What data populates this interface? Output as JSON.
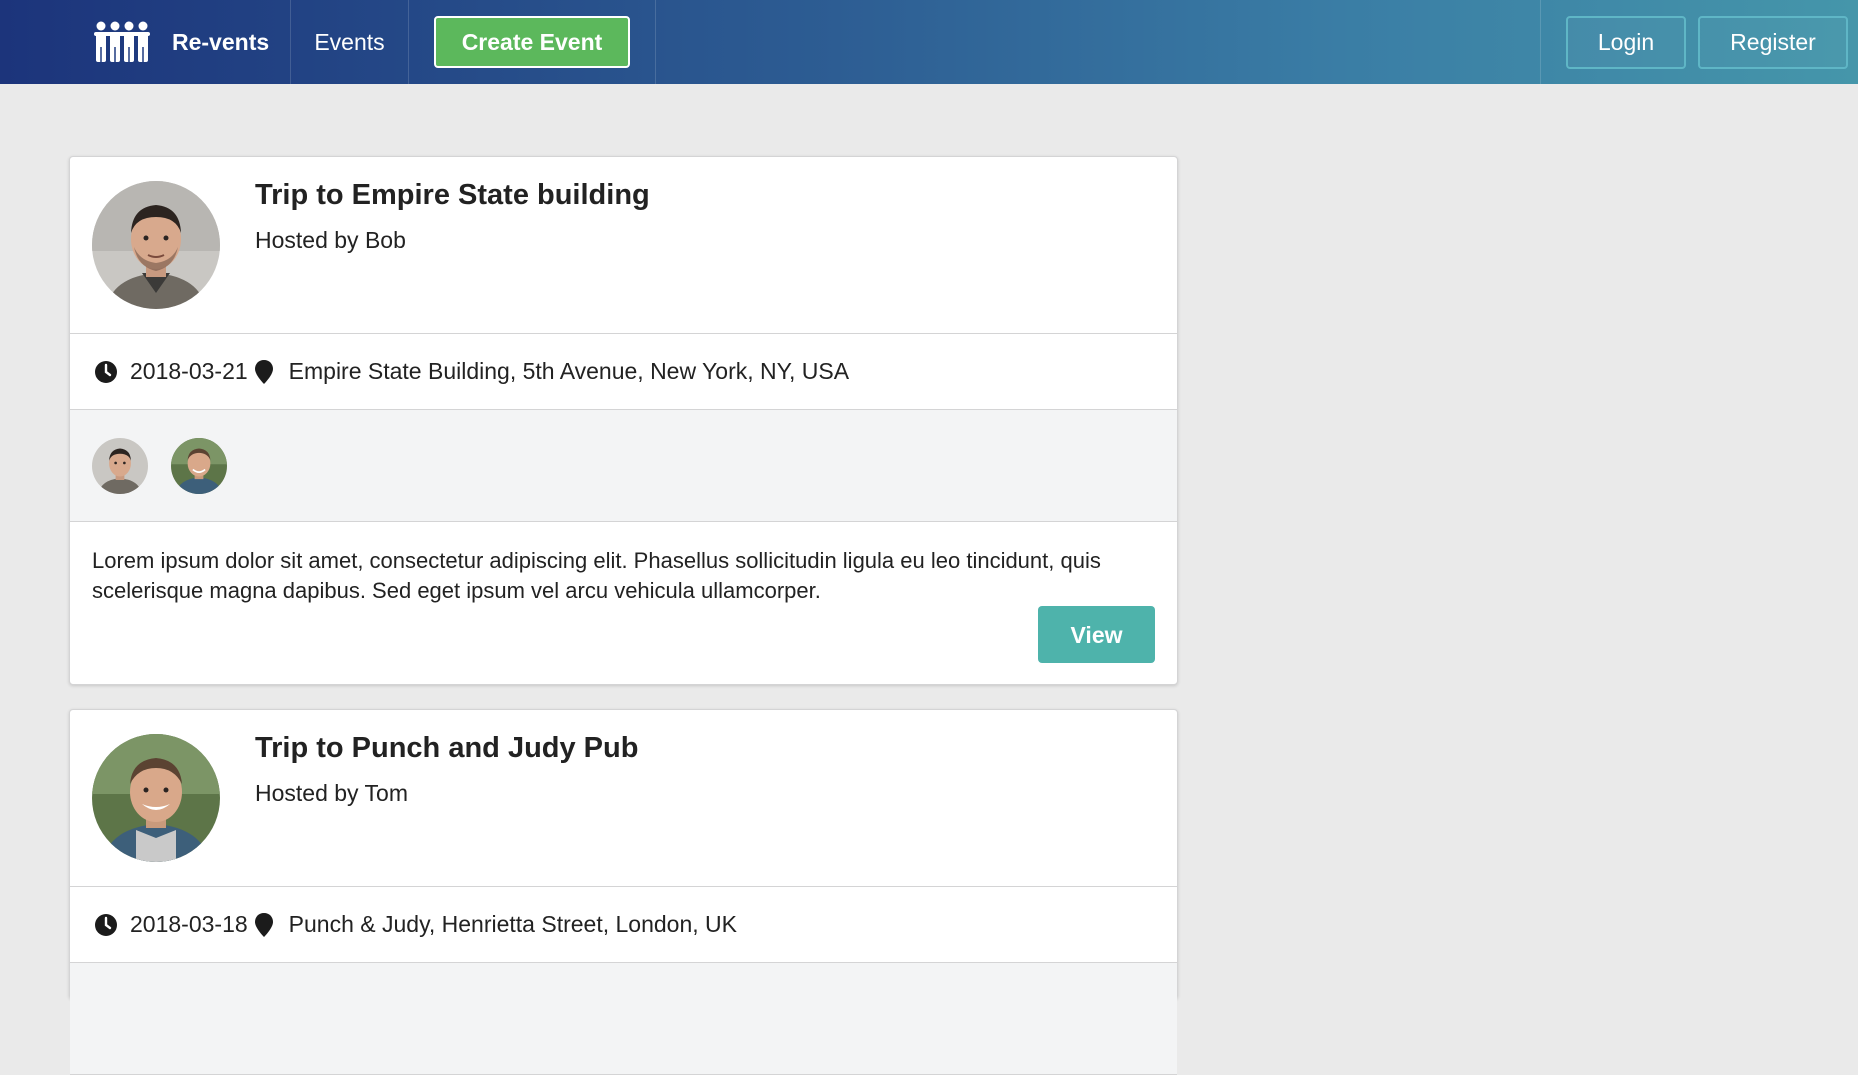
{
  "nav": {
    "brand": "Re-vents",
    "events": "Events",
    "create_event": "Create Event",
    "login": "Login",
    "register": "Register",
    "logo_icon": "people-group-icon"
  },
  "events": [
    {
      "title": "Trip to Empire State building",
      "hosted_by": "Hosted by Bob",
      "date": "2018-03-21",
      "venue": "Empire State Building, 5th Avenue, New York, NY, USA",
      "description": "Lorem ipsum dolor sit amet, consectetur adipiscing elit. Phasellus sollicitudin ligula eu leo tincidunt, quis scelerisque magna dapibus. Sed eget ipsum vel arcu vehicula ullamcorper.",
      "view": "View"
    },
    {
      "title": "Trip to Punch and Judy Pub",
      "hosted_by": "Hosted by Tom",
      "date": "2018-03-18",
      "venue": "Punch & Judy, Henrietta Street, London, UK"
    }
  ],
  "colors": {
    "create_button": "#5cb85c",
    "view_button": "#4eb3ab",
    "nav_start": "#1c347b",
    "nav_end": "#4596aa"
  }
}
